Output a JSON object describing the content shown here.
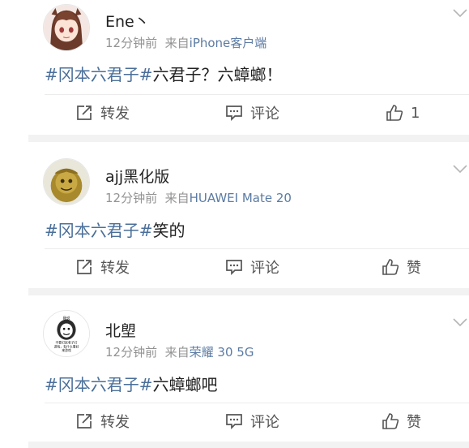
{
  "posts": [
    {
      "username": "Ene丶",
      "time": "12分钟前",
      "from_prefix": "来自",
      "source": "iPhone客户端",
      "content": {
        "topic": "#冈本六君子#",
        "text": "六君子？六蟑螂！"
      },
      "actions": {
        "repost": "转发",
        "comment": "评论",
        "like": "1"
      }
    },
    {
      "username": "ajj黑化版",
      "time": "12分钟前",
      "from_prefix": "来自",
      "source": "HUAWEI Mate 20",
      "content": {
        "topic": "#冈本六君子#",
        "text": "笑的"
      },
      "actions": {
        "repost": "转发",
        "comment": "评论",
        "like": "赞"
      }
    },
    {
      "username": "北塱",
      "time": "12分钟前",
      "from_prefix": "来自",
      "source": "荣耀 30 5G",
      "content": {
        "topic": "#冈本六君子#",
        "text": "六蟑螂吧"
      },
      "actions": {
        "repost": "转发",
        "comment": "评论",
        "like": "赞"
      },
      "avatar_text": {
        "top": "我说",
        "line1": "不要打扰老子打",
        "line2": "游戏，有什么事好",
        "line3": "来游戏"
      }
    }
  ],
  "colors": {
    "topic": "#4a6f9a",
    "source": "#5b7ba3",
    "separator": "#f2f2f2"
  },
  "icons": [
    "chevron-down-icon",
    "repost-icon",
    "comment-icon",
    "like-icon"
  ]
}
